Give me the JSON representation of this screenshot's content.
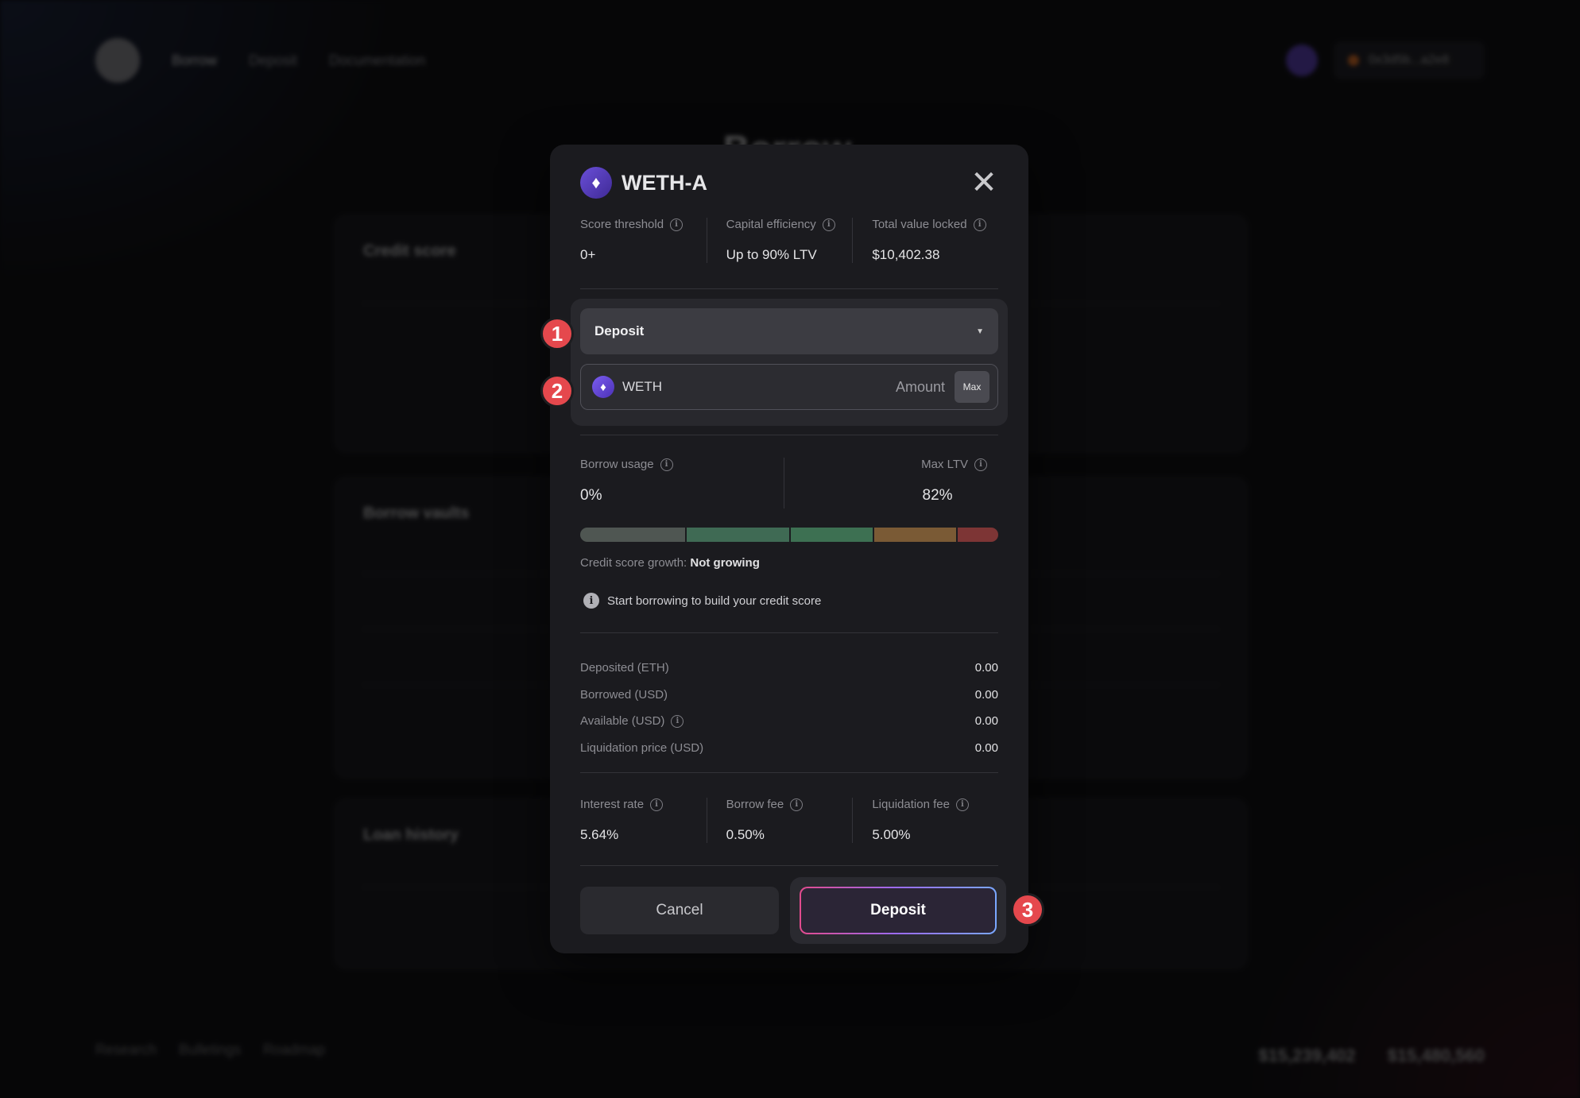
{
  "background": {
    "nav": [
      "Borrow",
      "Deposit",
      "Documentation"
    ],
    "wallet_label": "0x3d5b...a2e8",
    "page_title": "Borrow",
    "cards": [
      "Credit score",
      "Borrow vaults",
      "Loan history"
    ],
    "footer_links": [
      "Research",
      "Bulletings",
      "Roadmap"
    ],
    "footer_stats": [
      "$15,239,402",
      "$15,480,560"
    ]
  },
  "modal": {
    "title": "WETH-A",
    "close_glyph": "✕",
    "token_glyph": "♦",
    "stats": [
      {
        "label": "Score threshold",
        "value": "0+"
      },
      {
        "label": "Capital efficiency",
        "value": "Up to 90% LTV"
      },
      {
        "label": "Total value locked",
        "value": "$10,402.38"
      }
    ],
    "action_select": "Deposit",
    "token": "WETH",
    "amount_placeholder": "Amount",
    "max_label": "Max",
    "borrow_usage": {
      "label": "Borrow usage",
      "value": "0%"
    },
    "max_ltv": {
      "label": "Max LTV",
      "value": "82%"
    },
    "ltv_segments": [
      {
        "color": "#4f5652",
        "fraction": 0.25
      },
      {
        "color": "#3f6a54",
        "fraction": 0.25
      },
      {
        "color": "#3d7052",
        "fraction": 0.2
      },
      {
        "color": "#7a5a35",
        "fraction": 0.2
      },
      {
        "color": "#7d3535",
        "fraction": 0.1
      }
    ],
    "growth_label": "Credit score growth:",
    "growth_value": "Not growing",
    "notice": "Start borrowing to build your credit score",
    "details": [
      {
        "label": "Deposited (ETH)",
        "value": "0.00",
        "info": false
      },
      {
        "label": "Borrowed (USD)",
        "value": "0.00",
        "info": false
      },
      {
        "label": "Available (USD)",
        "value": "0.00",
        "info": true
      },
      {
        "label": "Liquidation price (USD)",
        "value": "0.00",
        "info": false
      }
    ],
    "fees": [
      {
        "label": "Interest rate",
        "value": "5.64%"
      },
      {
        "label": "Borrow fee",
        "value": "0.50%"
      },
      {
        "label": "Liquidation fee",
        "value": "5.00%"
      }
    ],
    "cancel_label": "Cancel",
    "deposit_label": "Deposit"
  },
  "steps": [
    "1",
    "2",
    "3"
  ],
  "colors": {
    "step_marker": "#e5484d",
    "modal_bg": "#1b1b1f",
    "accent_gradient": [
      "#e24b8e",
      "#9a6cf2",
      "#7aa8ff"
    ]
  }
}
